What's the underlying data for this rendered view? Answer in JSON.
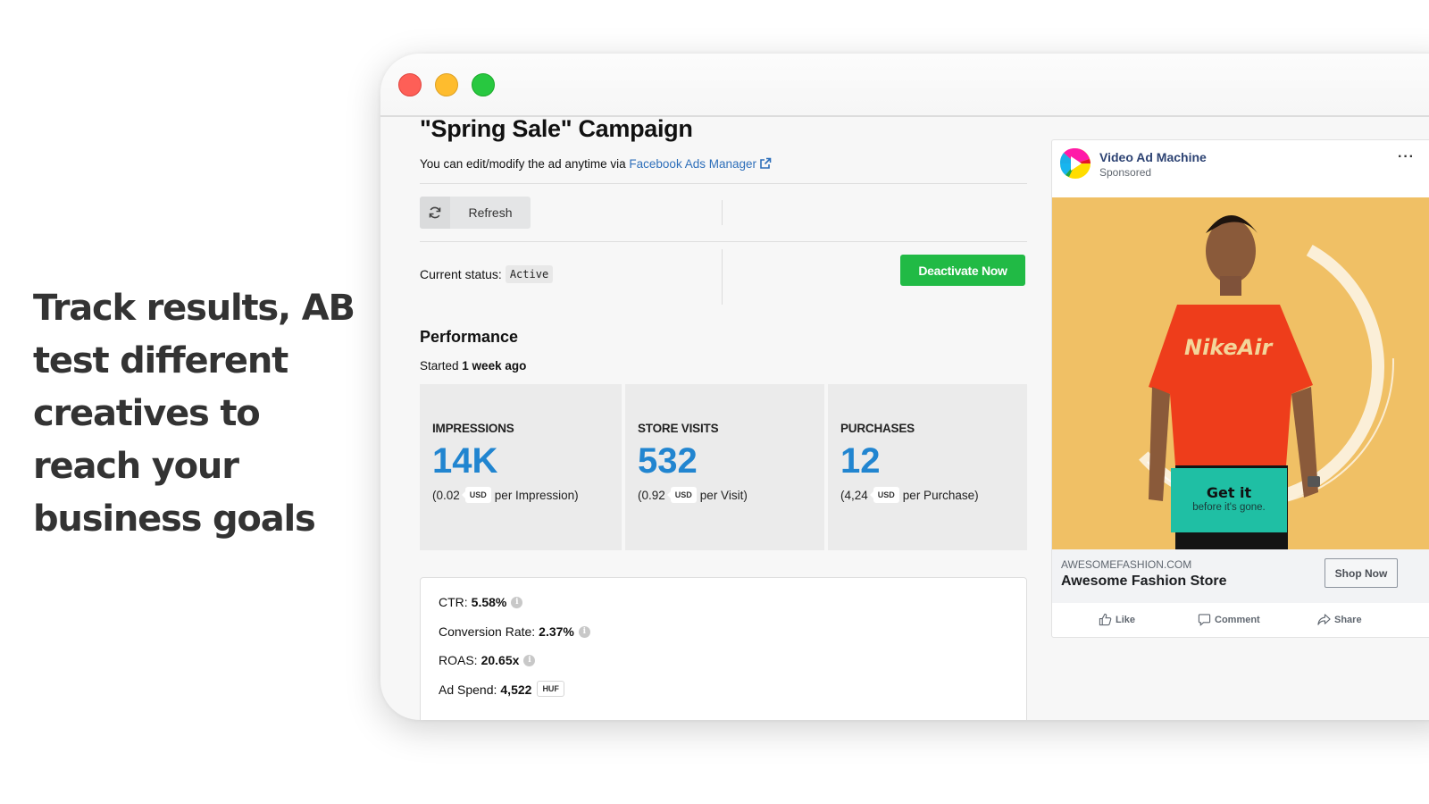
{
  "promo": {
    "headline": "Track results, AB test different creatives to reach your business goals"
  },
  "window": {
    "traffic_lights": [
      "close",
      "minimize",
      "maximize"
    ]
  },
  "campaign": {
    "title": "\"Spring Sale\" Campaign",
    "edit_note": "You can edit/modify the ad anytime via",
    "ads_manager_link": "Facebook Ads Manager",
    "refresh_label": "Refresh",
    "status_label": "Current status:",
    "status_value": "Active",
    "deactivate_label": "Deactivate Now"
  },
  "performance": {
    "title": "Performance",
    "started_prefix": "Started",
    "started_value": "1 week ago",
    "stats": [
      {
        "label": "IMPRESSIONS",
        "value": "14K",
        "cost": "(0.02",
        "unit": "USD",
        "per": "per Impression)"
      },
      {
        "label": "STORE VISITS",
        "value": "532",
        "cost": "(0.92",
        "unit": "USD",
        "per": "per Visit)"
      },
      {
        "label": "PURCHASES",
        "value": "12",
        "cost": "(4,24",
        "unit": "USD",
        "per": "per Purchase)"
      }
    ],
    "metrics": [
      {
        "label": "CTR:",
        "value": "5.58%"
      },
      {
        "label": "Conversion Rate:",
        "value": "2.37%"
      },
      {
        "label": "ROAS:",
        "value": "20.65x"
      },
      {
        "label": "Ad Spend:",
        "value": "4,522",
        "unit": "HUF"
      }
    ]
  },
  "ad_preview": {
    "page_name": "Video Ad Machine",
    "sponsored": "Sponsored",
    "more": "···",
    "shirt_text": "NikeAir",
    "cta_title": "Get it",
    "cta_subtitle": "before it's gone.",
    "domain": "AWESOMEFASHION.COM",
    "store_name": "Awesome Fashion Store",
    "shop_button": "Shop Now",
    "actions": [
      "Like",
      "Comment",
      "Share"
    ]
  },
  "colors": {
    "accent_blue": "#2185d0",
    "success_green": "#21ba45",
    "link_blue": "#2e6fba",
    "fb_name": "#2d4373"
  }
}
